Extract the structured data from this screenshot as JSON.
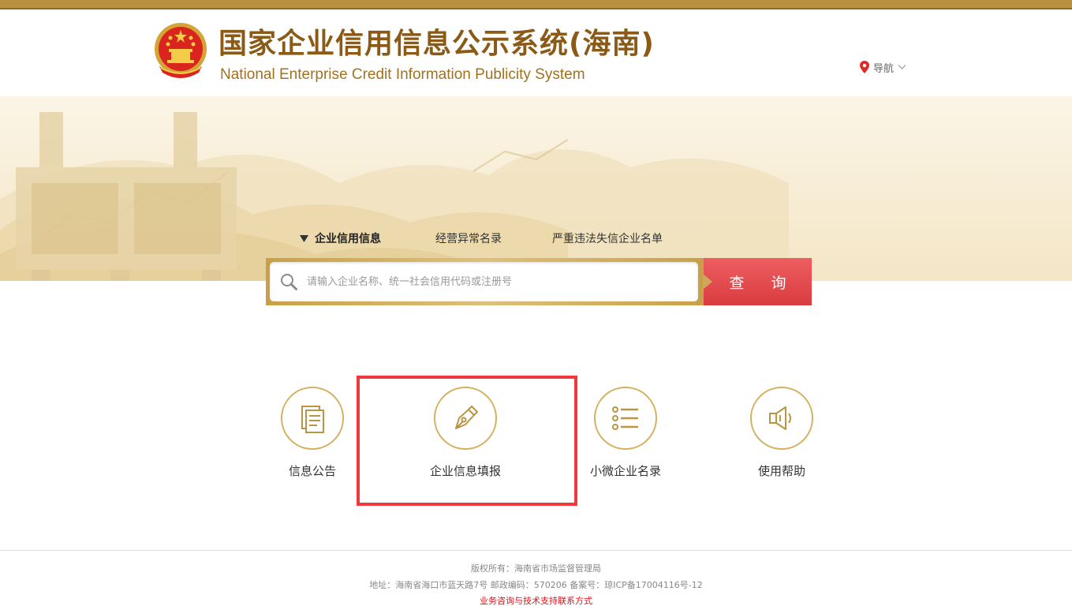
{
  "header": {
    "title": "国家企业信用信息公示系统(海南)",
    "subtitle": "National Enterprise Credit Information Publicity System",
    "nav_label": "导航"
  },
  "search": {
    "tabs": [
      {
        "label": "企业信用信息",
        "active": true
      },
      {
        "label": "经营异常名录",
        "active": false
      },
      {
        "label": "严重违法失信企业名单",
        "active": false
      }
    ],
    "placeholder": "请输入企业名称、统一社会信用代码或注册号",
    "button_label": "查 询"
  },
  "shortcuts": [
    {
      "label": "信息公告",
      "icon": "document-icon"
    },
    {
      "label": "企业信息填报",
      "icon": "pen-nib-icon",
      "highlighted": true
    },
    {
      "label": "小微企业名录",
      "icon": "list-icon"
    },
    {
      "label": "使用帮助",
      "icon": "speaker-icon"
    }
  ],
  "footer": {
    "copyright": "版权所有：海南省市场监督管理局",
    "address": "地址：海南省海口市蓝天路7号 邮政编码：570206 备案号：琼ICP备17004116号-12",
    "support_link": "业务咨询与技术支持联系方式"
  },
  "colors": {
    "accent_gold": "#b8903e",
    "title_brown": "#8b5a16",
    "button_red": "#e34a4e",
    "highlight_red": "#f0383d"
  }
}
